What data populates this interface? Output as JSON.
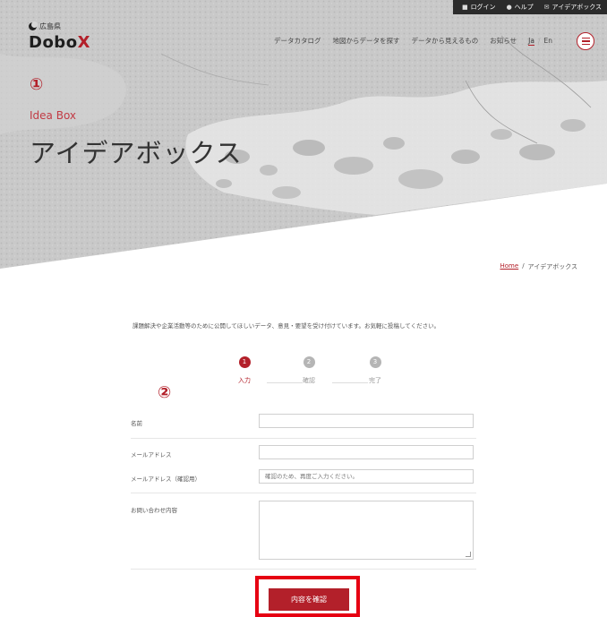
{
  "topbar": {
    "items": [
      {
        "label": "ログイン",
        "icon": "user-icon"
      },
      {
        "label": "ヘルプ",
        "icon": "help-icon"
      },
      {
        "label": "アイデアボックス",
        "icon": "mail-icon"
      }
    ]
  },
  "logo": {
    "prefecture": "広島県",
    "name_main": "Dobo",
    "name_accent": "X"
  },
  "nav": {
    "items": [
      "データカタログ",
      "地図からデータを探す",
      "データから見えるもの",
      "お知らせ"
    ],
    "lang_ja": "Ja",
    "lang_sep": "/",
    "lang_en": "En"
  },
  "annotations": {
    "one": "①",
    "two": "②"
  },
  "hero": {
    "subtitle": "Idea Box",
    "title": "アイデアボックス"
  },
  "breadcrumb": {
    "home": "Home",
    "sep": "/",
    "current": "アイデアボックス"
  },
  "intro": "課題解決や企業活動等のために公開してほしいデータ、意見・要望を受け付けています。お気軽に投稿してください。",
  "steps": [
    {
      "num": "1",
      "label": "入力",
      "state": "active"
    },
    {
      "num": "2",
      "label": "確認",
      "state": "inactive"
    },
    {
      "num": "3",
      "label": "完了",
      "state": "inactive"
    }
  ],
  "form": {
    "name_label": "名前",
    "name_value": "",
    "email_label": "メールアドレス",
    "email_value": "",
    "email_confirm_label": "メールアドレス（確認用）",
    "email_confirm_placeholder": "確認のため、再度ご入力ください。",
    "inquiry_label": "お問い合わせ内容",
    "inquiry_value": ""
  },
  "confirm_button": "内容を確認",
  "colors": {
    "accent": "#b3202a",
    "highlight": "#e60012",
    "topbar": "#2b2b2b"
  }
}
